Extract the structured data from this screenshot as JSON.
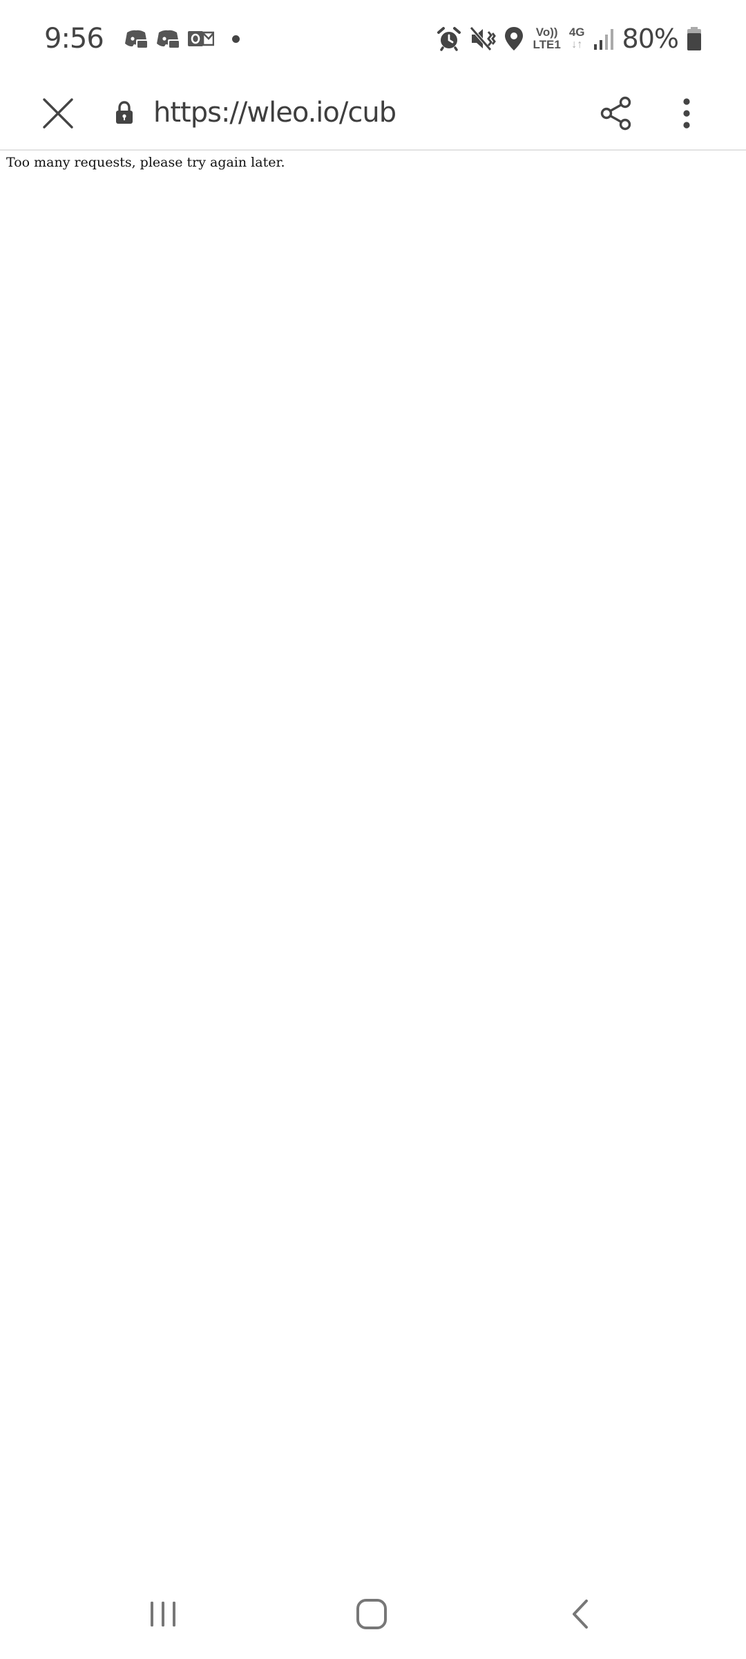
{
  "status_bar": {
    "time": "9:56",
    "notification_icons": [
      "discord-icon",
      "discord-icon",
      "outlook-icon"
    ],
    "system_icons": [
      "alarm-icon",
      "vibrate-icon",
      "location-icon",
      "volte-icon",
      "4g-data-icon",
      "signal-icon",
      "battery-icon"
    ],
    "volte_top": "Vo))",
    "volte_bottom": "LTE1",
    "network_type": "4G",
    "network_arrows": "↓↑",
    "battery_percent": "80%",
    "battery_level": 0.8
  },
  "toolbar": {
    "url": "https://wleo.io/cub",
    "icons": [
      "close-icon",
      "lock-icon",
      "share-icon",
      "more-vert-icon"
    ]
  },
  "page": {
    "message": "Too many requests, please try again later."
  },
  "navbar": {
    "icons": [
      "recents-icon",
      "home-icon",
      "back-icon"
    ]
  },
  "colors": {
    "icon": "#444444",
    "divider": "#e3e3e3",
    "background": "#ffffff",
    "page_text": "#111111"
  }
}
